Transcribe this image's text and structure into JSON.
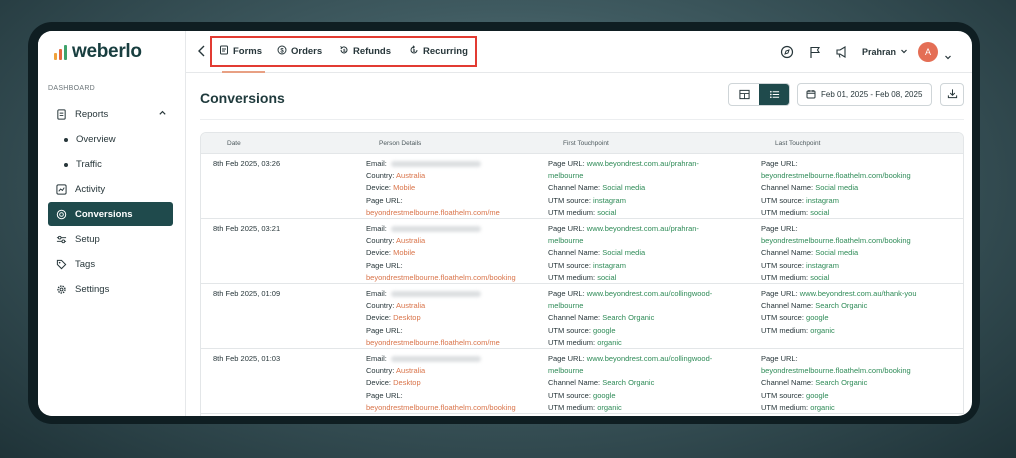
{
  "brand": {
    "name": "weberlo",
    "logo_colors": [
      "#f0a23a",
      "#e4683d",
      "#3fa36b",
      "#1f4a4c"
    ]
  },
  "sidebar": {
    "section_label": "DASHBOARD",
    "reports": {
      "label": "Reports",
      "icon": "document-icon",
      "expanded": true
    },
    "sub_items": [
      {
        "label": "Overview"
      },
      {
        "label": "Traffic"
      }
    ],
    "items": [
      {
        "label": "Activity",
        "icon": "chart-icon",
        "active": false
      },
      {
        "label": "Conversions",
        "icon": "target-icon",
        "active": true
      },
      {
        "label": "Setup",
        "icon": "sliders-icon",
        "active": false
      },
      {
        "label": "Tags",
        "icon": "tag-icon",
        "active": false
      },
      {
        "label": "Settings",
        "icon": "gear-icon",
        "active": false
      }
    ]
  },
  "topbar": {
    "tabs": [
      {
        "label": "Forms",
        "icon": "form-icon",
        "active": true
      },
      {
        "label": "Orders",
        "icon": "dollar-icon",
        "active": false
      },
      {
        "label": "Refunds",
        "icon": "refund-icon",
        "active": false
      },
      {
        "label": "Recurring",
        "icon": "recurring-icon",
        "active": false
      }
    ],
    "user_name": "Prahran",
    "avatar_initial": "A",
    "accent_color": "#e23b32"
  },
  "page": {
    "title": "Conversions",
    "date_range": "Feb 01, 2025 - Feb 08, 2025"
  },
  "table": {
    "columns": [
      "Date",
      "Person Details",
      "First Touchpoint",
      "Last Touchpoint"
    ],
    "labels": {
      "email": "Email:",
      "country": "Country:",
      "device": "Device:",
      "page_url": "Page URL:",
      "channel": "Channel Name:",
      "utm_source": "UTM source:",
      "utm_medium": "UTM medium:"
    },
    "rows": [
      {
        "date": "8th Feb 2025, 03:26",
        "country": "Australia",
        "device": "Mobile",
        "person_url": "beyondrestmelbourne.floathelm.com/me",
        "first": {
          "url": "www.beyondrest.com.au/prahran-",
          "url_cont": "melbourne",
          "channel": "Social media",
          "source": "instagram",
          "medium": "social"
        },
        "last": {
          "url": "",
          "url_cont": "beyondrestmelbourne.floathelm.com/booking",
          "channel": "Social media",
          "source": "instagram",
          "medium": "social"
        }
      },
      {
        "date": "8th Feb 2025, 03:21",
        "country": "Australia",
        "device": "Mobile",
        "person_url": "beyondrestmelbourne.floathelm.com/booking",
        "first": {
          "url": "www.beyondrest.com.au/prahran-",
          "url_cont": "melbourne",
          "channel": "Social media",
          "source": "instagram",
          "medium": "social"
        },
        "last": {
          "url": "",
          "url_cont": "beyondrestmelbourne.floathelm.com/booking",
          "channel": "Social media",
          "source": "instagram",
          "medium": "social"
        }
      },
      {
        "date": "8th Feb 2025, 01:09",
        "country": "Australia",
        "device": "Desktop",
        "person_url": "beyondrestmelbourne.floathelm.com/me",
        "first": {
          "url": "www.beyondrest.com.au/collingwood-",
          "url_cont": "melbourne",
          "channel": "Search Organic",
          "source": "google",
          "medium": "organic"
        },
        "last": {
          "url": "www.beyondrest.com.au/thank-you",
          "url_cont": "",
          "channel": "Search Organic",
          "source": "google",
          "medium": "organic"
        }
      },
      {
        "date": "8th Feb 2025, 01:03",
        "country": "Australia",
        "device": "Desktop",
        "person_url": "beyondrestmelbourne.floathelm.com/booking",
        "first": {
          "url": "www.beyondrest.com.au/collingwood-",
          "url_cont": "melbourne",
          "channel": "Search Organic",
          "source": "google",
          "medium": "organic"
        },
        "last": {
          "url": "",
          "url_cont": "beyondrestmelbourne.floathelm.com/booking",
          "channel": "Search Organic",
          "source": "google",
          "medium": "organic"
        }
      }
    ]
  }
}
